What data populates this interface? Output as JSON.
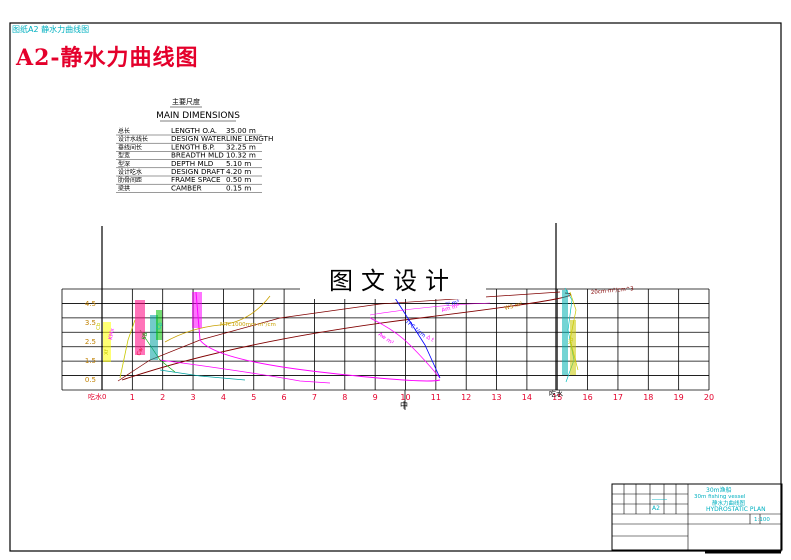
{
  "drawing": {
    "top_label": "图纸A2 静水力曲线图",
    "title": "A2-静水力曲线图",
    "watermark": "图文设计"
  },
  "dimensions": {
    "heading_cn": "主要尺度",
    "heading_en": "MAIN DIMENSIONS",
    "rows": [
      {
        "cn": "总长",
        "en": "LENGTH O.A.",
        "value": "35.00  m"
      },
      {
        "cn": "设计水线长",
        "en": "DESIGN WATERLINE LENGTH",
        "value": ""
      },
      {
        "cn": "垂线间长",
        "en": "LENGTH B.P.",
        "value": "32.25  m"
      },
      {
        "cn": "型宽",
        "en": "BREADTH MLD",
        "value": "10.32  m"
      },
      {
        "cn": "型深",
        "en": "DEPTH MLD",
        "value": "5.10  m"
      },
      {
        "cn": "设计吃水",
        "en": "DESIGN DRAFT",
        "value": "4.20  m"
      },
      {
        "cn": "肋骨间距",
        "en": "FRAME SPACE",
        "value": "0.50  m"
      },
      {
        "cn": "梁拱",
        "en": "CAMBER",
        "value": "0.15  m"
      }
    ]
  },
  "axes": {
    "x_title": "吃水",
    "x_zero_label": "吃水0",
    "x_ticks": [
      "1",
      "2",
      "3",
      "4",
      "5",
      "6",
      "7",
      "8",
      "9",
      "10",
      "11",
      "12",
      "13",
      "14",
      "15",
      "16",
      "17",
      "18",
      "19",
      "20"
    ],
    "y_ticks": [
      "4.5",
      "3.5",
      "2.5",
      "1.5",
      "0.5"
    ],
    "midship_mark": "中",
    "colors": {
      "x_ticks": "#e4002b",
      "y_ticks": "#c08000",
      "grid": "#000000"
    }
  },
  "curve_labels": [
    {
      "text": "KMx",
      "color": "#ff00ff"
    },
    {
      "text": "KB",
      "color": "#00a000"
    },
    {
      "text": "Cb",
      "color": "#c8c800"
    },
    {
      "text": "Cp",
      "color": "#00c0c0"
    },
    {
      "text": "Cw",
      "color": "#e4002b"
    },
    {
      "text": "Xf",
      "color": "#c8c800"
    },
    {
      "text": "Xb",
      "color": "#c8c800"
    },
    {
      "text": "MTC1000mm·m²/cm",
      "color": "#c8a000"
    },
    {
      "text": "TPC t/cm",
      "color": "#0000ff"
    },
    {
      "text": "Aw m²",
      "color": "#ff00ff"
    },
    {
      "text": "Am m²",
      "color": "#ff00ff"
    },
    {
      "text": "WS m²",
      "color": "#c08000"
    },
    {
      "text": "Δ t",
      "color": "#ff00ff"
    },
    {
      "text": "▽ m³",
      "color": "#0000ff"
    },
    {
      "text": "20cm·m²/cm^3",
      "color": "#800000"
    }
  ],
  "title_block": {
    "line1": "30m渔船",
    "line2": "30m fishing vessel",
    "line3": "静水力曲线图",
    "line4": "HYDROSTATIC PLAN",
    "code": "A2",
    "scale": "1:100"
  }
}
